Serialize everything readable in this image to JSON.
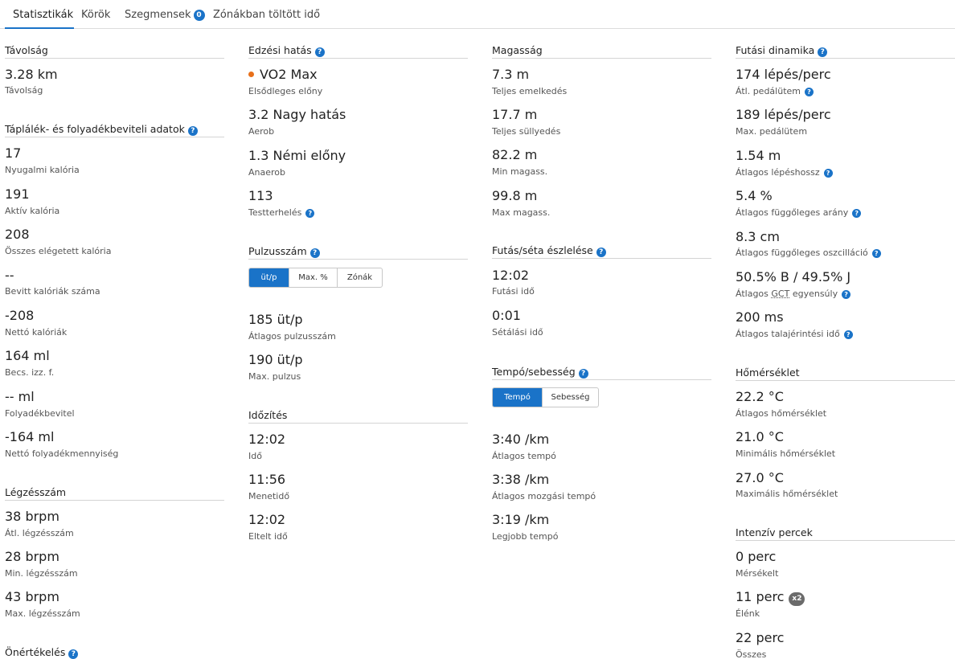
{
  "tabs": [
    {
      "label": "Statisztikák"
    },
    {
      "label": "Körök"
    },
    {
      "label": "Szegmensek",
      "count": "0"
    },
    {
      "label": "Zónákban töltött idő"
    }
  ],
  "help_glyph": "?",
  "col1": {
    "distance": {
      "title": "Távolság",
      "value": "3.28 km",
      "label": "Távolság"
    },
    "nutrition": {
      "title": "Táplálék- és folyadékbeviteli adatok",
      "items": [
        {
          "value": "17",
          "label": "Nyugalmi kalória"
        },
        {
          "value": "191",
          "label": "Aktív kalória"
        },
        {
          "value": "208",
          "label": "Összes elégetett kalória"
        },
        {
          "value": "--",
          "label": "Bevitt kalóriák száma"
        },
        {
          "value": "-208",
          "label": "Nettó kalóriák"
        },
        {
          "value": "164 ml",
          "label": "Becs. izz. f."
        },
        {
          "value": "-- ml",
          "label": "Folyadékbevitel"
        },
        {
          "value": "-164 ml",
          "label": "Nettó folyadékmennyiség"
        }
      ]
    },
    "respiration": {
      "title": "Légzésszám",
      "items": [
        {
          "value": "38 brpm",
          "label": "Átl. légzésszám"
        },
        {
          "value": "28 brpm",
          "label": "Min. légzésszám"
        },
        {
          "value": "43 brpm",
          "label": "Max. légzésszám"
        }
      ]
    },
    "self_eval": {
      "title": "Önértékelés"
    }
  },
  "col2": {
    "training_effect": {
      "title": "Edzési hatás",
      "items": [
        {
          "value": "VO2 Max",
          "label": "Elsődleges előny"
        },
        {
          "value": "3.2 Nagy hatás",
          "label": "Aerob"
        },
        {
          "value": "1.3 Némi előny",
          "label": "Anaerob"
        },
        {
          "value": "113",
          "label": "Testterhelés"
        }
      ]
    },
    "heart_rate": {
      "title": "Pulzusszám",
      "toggle": [
        "üt/p",
        "Max. %",
        "Zónák"
      ],
      "items": [
        {
          "value": "185 üt/p",
          "label": "Átlagos pulzusszám"
        },
        {
          "value": "190 üt/p",
          "label": "Max. pulzus"
        }
      ]
    },
    "timing": {
      "title": "Időzítés",
      "items": [
        {
          "value": "12:02",
          "label": "Idő"
        },
        {
          "value": "11:56",
          "label": "Menetidő"
        },
        {
          "value": "12:02",
          "label": "Eltelt idő"
        }
      ]
    }
  },
  "col3": {
    "elevation": {
      "title": "Magasság",
      "items": [
        {
          "value": "7.3 m",
          "label": "Teljes emelkedés"
        },
        {
          "value": "17.7 m",
          "label": "Teljes süllyedés"
        },
        {
          "value": "82.2 m",
          "label": "Min magass."
        },
        {
          "value": "99.8 m",
          "label": "Max magass."
        }
      ]
    },
    "run_walk": {
      "title": "Futás/séta észlelése",
      "items": [
        {
          "value": "12:02",
          "label": "Futási idő"
        },
        {
          "value": "0:01",
          "label": "Sétálási idő"
        }
      ]
    },
    "pace": {
      "title": "Tempó/sebesség",
      "toggle": [
        "Tempó",
        "Sebesség"
      ],
      "items": [
        {
          "value": "3:40 /km",
          "label": "Átlagos tempó"
        },
        {
          "value": "3:38 /km",
          "label": "Átlagos mozgási tempó"
        },
        {
          "value": "3:19 /km",
          "label": "Legjobb tempó"
        }
      ]
    }
  },
  "col4": {
    "dynamics": {
      "title": "Futási dinamika",
      "items": [
        {
          "value": "174 lépés/perc",
          "label": "Átl. pedálütem"
        },
        {
          "value": "189 lépés/perc",
          "label": "Max. pedálütem"
        },
        {
          "value": "1.54 m",
          "label": "Átlagos lépéshossz"
        },
        {
          "value": "5.4 %",
          "label": "Átlagos függőleges arány"
        },
        {
          "value": "8.3 cm",
          "label": "Átlagos függőleges oszcilláció"
        },
        {
          "value": "50.5% B / 49.5% J",
          "label_pre": "Átlagos ",
          "label_abbr": "GCT",
          "label_post": " egyensúly"
        },
        {
          "value": "200 ms",
          "label": "Átlagos talajérintési idő"
        }
      ]
    },
    "temperature": {
      "title": "Hőmérséklet",
      "items": [
        {
          "value": "22.2 °C",
          "label": "Átlagos hőmérséklet"
        },
        {
          "value": "21.0 °C",
          "label": "Minimális hőmérséklet"
        },
        {
          "value": "27.0 °C",
          "label": "Maximális hőmérséklet"
        }
      ]
    },
    "intensity": {
      "title": "Intenzív percek",
      "multiplier": "x2",
      "items": [
        {
          "value": "0 perc",
          "label": "Mérsékelt"
        },
        {
          "value": "11 perc",
          "label": "Élénk"
        },
        {
          "value": "22 perc",
          "label": "Összes"
        }
      ]
    }
  },
  "colors": {
    "accent": "#1a73c8",
    "dot": "#e8701a",
    "badge_gray": "#6b6b6b"
  }
}
